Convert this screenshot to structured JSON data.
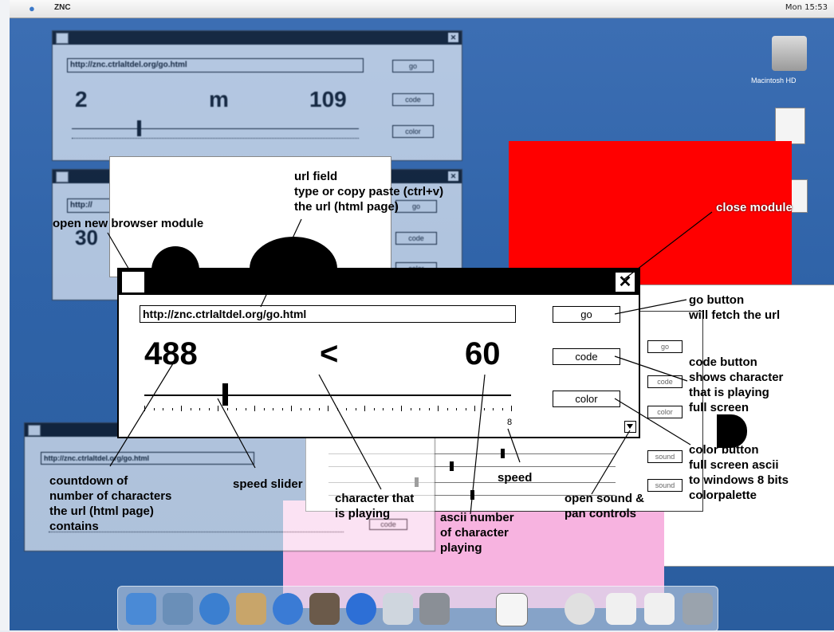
{
  "menubar": {
    "app": "ZNC",
    "status": "Mon 15:53"
  },
  "desktop": {
    "hd_label": "Macintosh HD"
  },
  "bg_window_1": {
    "url": "http://znc.ctrlaltdel.org/go.html",
    "left": "2",
    "mid": "m",
    "right": "109",
    "buttons": [
      "go",
      "code",
      "color"
    ]
  },
  "bg_window_2": {
    "url": "http://",
    "left": "30",
    "buttons": [
      "go",
      "code",
      "color"
    ]
  },
  "bg_window_3": {
    "url": "http://znc.ctrlaltdel.org/go.html",
    "buttons": [
      "code"
    ]
  },
  "main_window": {
    "url": "http://znc.ctrlaltdel.org/go.html",
    "countdown": "488",
    "character": "<",
    "ascii": "60",
    "speed_value": "8",
    "go_label": "go",
    "code_label": "code",
    "color_label": "color",
    "close_glyph": "✕",
    "slider_position": 0.22
  },
  "sound_panel": {
    "buttons": [
      "go",
      "code",
      "color",
      "sound",
      "sound"
    ]
  },
  "annotations": {
    "url_field": [
      "url field",
      "type or copy paste (ctrl+v)",
      "the url (html page)"
    ],
    "open_new": "open new browser module",
    "close_module": "close module",
    "go_button": [
      "go button",
      "will fetch the url"
    ],
    "code_button": [
      "code button",
      "shows character",
      "that is playing",
      "full screen"
    ],
    "color_button": [
      "color button",
      "full screen ascii",
      "to windows 8 bits",
      "colorpalette"
    ],
    "countdown": [
      "countdown of",
      "number of characters",
      "the url (html page)",
      "contains"
    ],
    "speed_slider": "speed slider",
    "character_playing": [
      "character that",
      "is playing"
    ],
    "speed": "speed",
    "ascii_number": [
      "ascii number",
      "of character",
      "playing"
    ],
    "open_sound": [
      "open sound &",
      "pan controls"
    ]
  },
  "colors": {
    "desktop": "#2f63a8",
    "red_window": "#ff0000",
    "pink_window": "#f7b3e0"
  }
}
